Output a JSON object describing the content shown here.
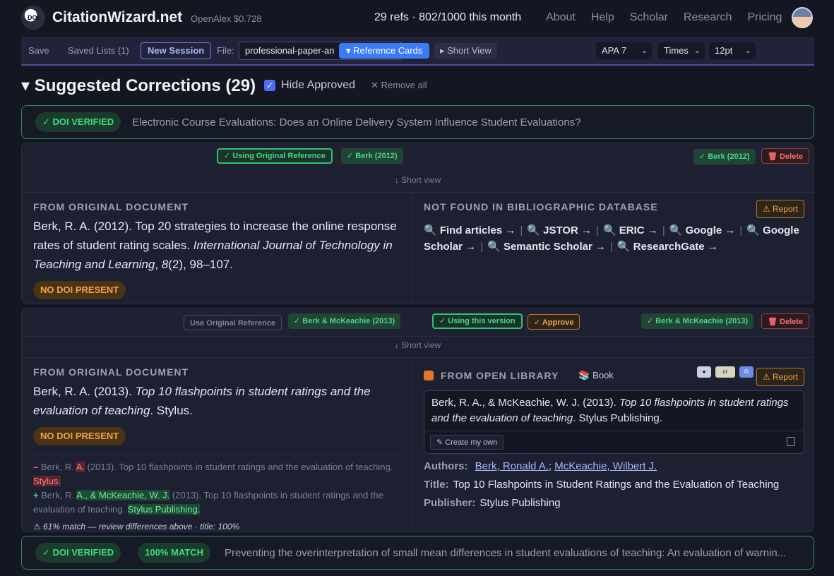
{
  "header": {
    "brand": "CitationWizard.net",
    "openalex": "OpenAlex $0.728",
    "stats": "29 refs · 802/1000 this month",
    "nav": [
      "About",
      "Help",
      "Scholar",
      "Research",
      "Pricing"
    ]
  },
  "toolbar": {
    "save": "Save",
    "saved_lists": "Saved Lists (1)",
    "new_session": "New Session",
    "file_label": "File:",
    "file_value": "professional-paper-an",
    "reference_cards": "▾ Reference Cards",
    "short_view": "▸ Short View",
    "style": "APA 7",
    "font": "Times",
    "size": "12pt"
  },
  "section": {
    "title": "▾ Suggested Corrections (29)",
    "hide_approved": "Hide Approved",
    "remove_all": "✕ Remove all"
  },
  "verified_1": {
    "badge": "✓ DOI VERIFIED",
    "title": "Electronic Course Evaluations: Does an Online Delivery System Influence Student Evaluations?"
  },
  "card1": {
    "using_original": "✓ Using Original Reference",
    "tag": "✓ Berk (2012)",
    "tag_right": "✓ Berk (2012)",
    "delete": "🗑 Delete",
    "short_view": "↓ Short view",
    "left_label": "FROM ORIGINAL DOCUMENT",
    "ref_plain": "Berk, R. A. (2012). Top 20 strategies to increase the online response rates of student rating scales. ",
    "ref_journal": "International Journal of Technology in Teaching and Learning",
    "ref_sep": ", ",
    "ref_volume": "8",
    "ref_tail": "(2), 98–107.",
    "no_doi": "NO DOI PRESENT",
    "right_label": "NOT FOUND IN BIBLIOGRAPHIC DATABASE",
    "report": "⚠ Report",
    "links": [
      "🔍 Find articles →",
      "🔍 JSTOR →",
      "🔍 ERIC →",
      "🔍 Google →",
      "🔍 Google Scholar →",
      "🔍 Semantic Scholar →",
      "🔍 ResearchGate →"
    ]
  },
  "card2": {
    "use_original": "Use Original Reference",
    "tag": "✓ Berk & McKeachie (2013)",
    "using_version": "✓ Using this version",
    "approve": "✓ Approve",
    "tag_right": "✓ Berk & McKeachie (2013)",
    "delete": "🗑 Delete",
    "short_view": "↓ Short view",
    "left_label": "FROM ORIGINAL DOCUMENT",
    "ref_plain": "Berk, R. A. (2013). ",
    "ref_title": "Top 10 flashpoints in student ratings and the evaluation of teaching",
    "ref_tail": ". Stylus.",
    "no_doi": "NO DOI PRESENT",
    "diff_minus_a": "Berk, R. ",
    "diff_minus_del1": "A.",
    "diff_minus_b": " (2013). Top 10 flashpoints in student ratings and the evaluation of teaching. ",
    "diff_minus_del2": "Stylus.",
    "diff_plus_a": "Berk, R. ",
    "diff_plus_ins1": "A., & McKeachie, W. J.",
    "diff_plus_b": " (2013). Top 10 flashpoints in student ratings and the evaluation of teaching. ",
    "diff_plus_ins2": "Stylus Publishing.",
    "match_note": "⚠ 61% match — review differences above · title: 100%",
    "right_label": "FROM OPEN LIBRARY",
    "book_badge": "📚 Book",
    "report": "⚠ Report",
    "ol_plain": "Berk, R. A., & McKeachie, W. J. (2013). ",
    "ol_title": "Top 10 flashpoints in student ratings and the evaluation of teaching",
    "ol_tail": ". Stylus Publishing.",
    "create_own": "✎ Create my own",
    "authors_label": "Authors:",
    "author_1": "Berk, Ronald A.",
    "author_sep": ";",
    "author_2": "McKeachie, Wilbert J.",
    "title_label": "Title:",
    "title_value": "Top 10 Flashpoints in Student Ratings and the Evaluation of Teaching",
    "publisher_label": "Publisher:",
    "publisher_value": "Stylus Publishing"
  },
  "verified_2": {
    "badge": "✓ DOI VERIFIED",
    "match": "100% MATCH",
    "title": "Preventing the overinterpretation of small mean differences in student evaluations of teaching: An evaluation of warnin..."
  },
  "colors": {
    "background": "#141622",
    "accent_blue": "#3b7bf6",
    "success_green": "#48d68c",
    "warning_orange": "#f0a24a",
    "danger_red": "#ff6b6b"
  }
}
